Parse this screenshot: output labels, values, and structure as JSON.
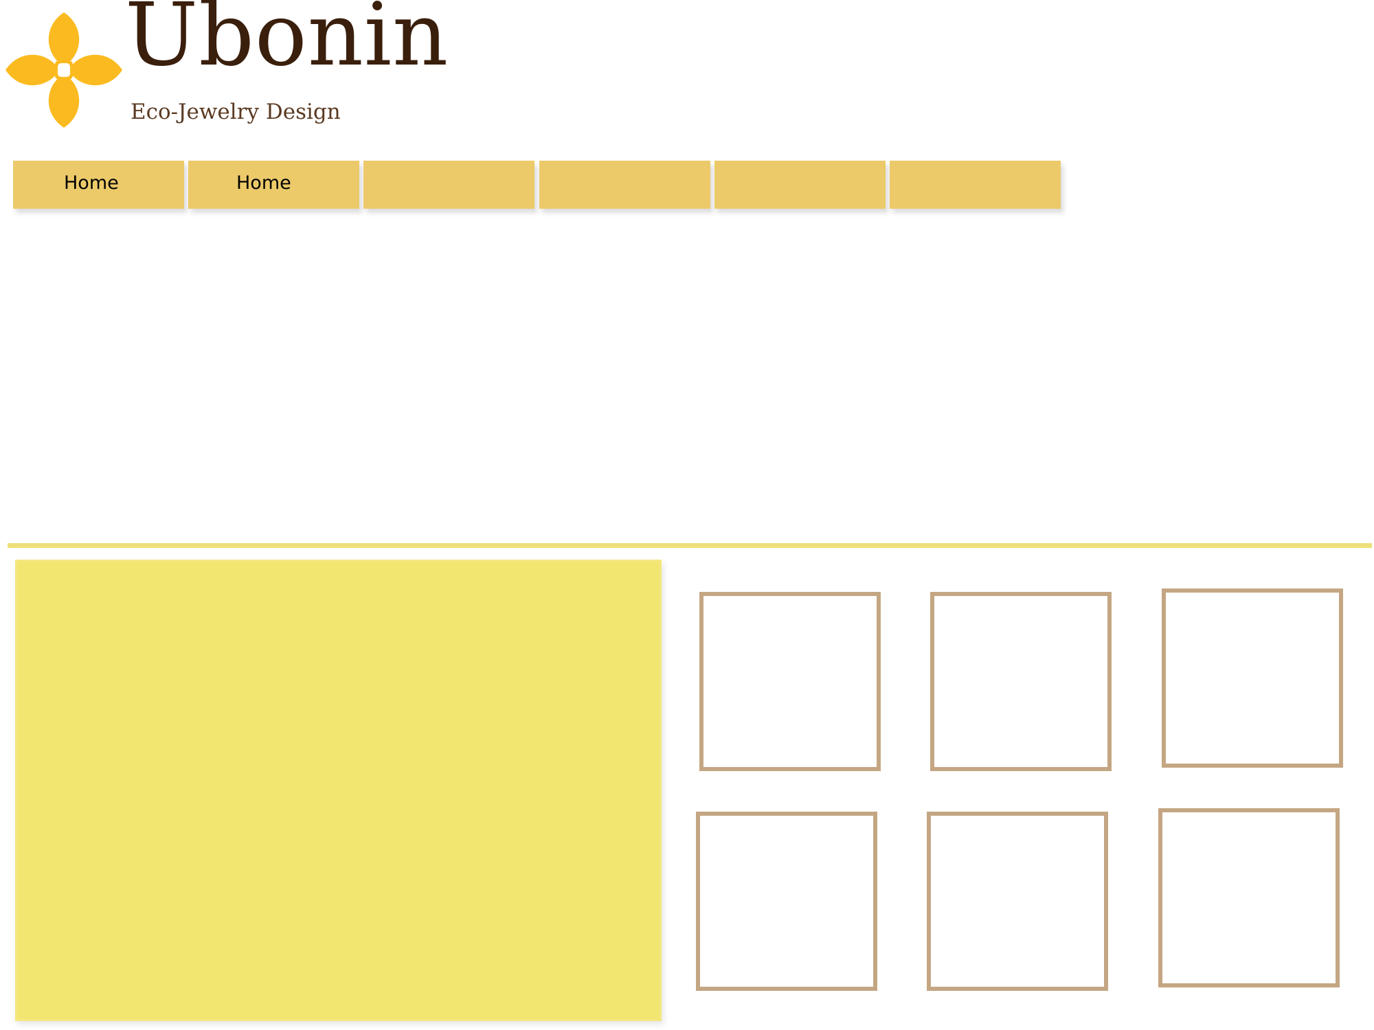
{
  "brand": {
    "name": "Ubonin",
    "tagline": "Eco-Jewelry Design",
    "logo_icon": "four-petal-flower-icon"
  },
  "nav": {
    "items": [
      {
        "label": "Home"
      },
      {
        "label": "Home"
      },
      {
        "label": ""
      },
      {
        "label": ""
      },
      {
        "label": ""
      },
      {
        "label": ""
      }
    ]
  },
  "gallery": {
    "thumbnail_count": 6
  },
  "colors": {
    "flower": "#fbbb20",
    "brand_brown": "#3a1f0c",
    "tagline_brown": "#5a3a22",
    "nav_gold": "#ecca6a",
    "divider_yellow": "#ede07a",
    "panel_yellow": "#f2e570",
    "frame_tan": "#c4a683"
  }
}
